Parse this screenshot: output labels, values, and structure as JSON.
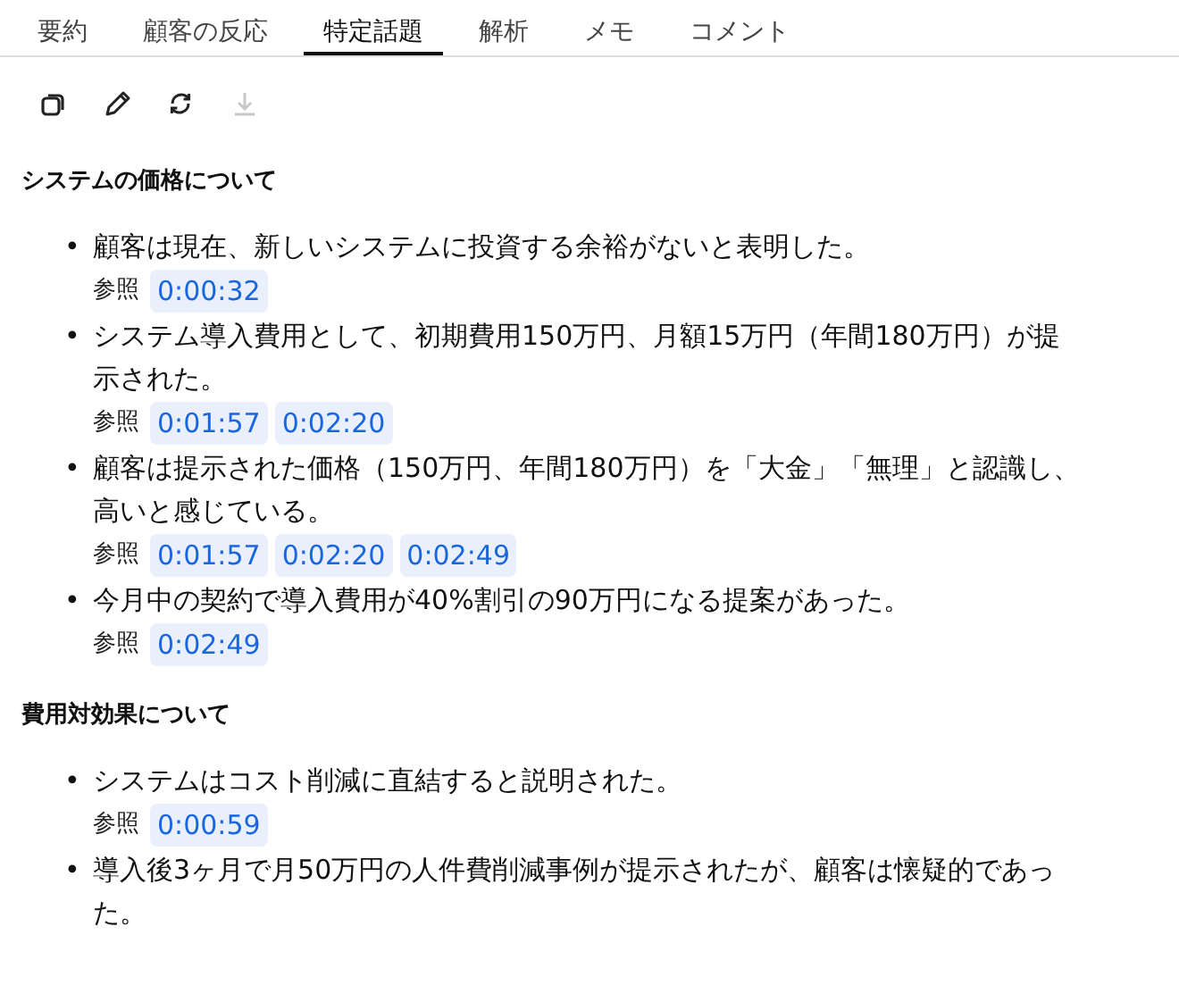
{
  "tabs": [
    {
      "label": "要約",
      "selected": false
    },
    {
      "label": "顧客の反応",
      "selected": false
    },
    {
      "label": "特定話題",
      "selected": true
    },
    {
      "label": "解析",
      "selected": false
    },
    {
      "label": "メモ",
      "selected": false
    },
    {
      "label": "コメント",
      "selected": false
    }
  ],
  "toolbar": [
    {
      "kind": "copy",
      "disabled": false
    },
    {
      "kind": "edit",
      "disabled": false
    },
    {
      "kind": "refresh",
      "disabled": false
    },
    {
      "kind": "download",
      "disabled": true
    }
  ],
  "sections": [
    {
      "title": "システムの価格について",
      "items": [
        {
          "bullet": "•",
          "text": "顧客は現在、新しいシステムに投資する余裕がないと表明した。",
          "ref_label": "参照",
          "refs": [
            "0:00:32"
          ]
        },
        {
          "bullet": "•",
          "text": "システム導入費用として、初期費用150万円、月額15万円（年間180万円）が提示された。",
          "ref_label": "参照",
          "refs": [
            "0:01:57",
            "0:02:20"
          ]
        },
        {
          "bullet": "•",
          "text": "顧客は提示された価格（150万円、年間180万円）を「大金」「無理」と認識し、高いと感じている。",
          "ref_label": "参照",
          "refs": [
            "0:01:57",
            "0:02:20",
            "0:02:49"
          ]
        },
        {
          "bullet": "•",
          "text": "今月中の契約で導入費用が40%割引の90万円になる提案があった。",
          "ref_label": "参照",
          "refs": [
            "0:02:49"
          ]
        }
      ]
    },
    {
      "title": "費用対効果について",
      "items": [
        {
          "bullet": "•",
          "text": "システムはコスト削減に直結すると説明された。",
          "ref_label": "参照",
          "refs": [
            "0:00:59"
          ]
        },
        {
          "bullet": "•",
          "text": "導入後3ヶ月で月50万円の人件費削減事例が提示されたが、顧客は懐疑的であった。"
        }
      ]
    }
  ]
}
